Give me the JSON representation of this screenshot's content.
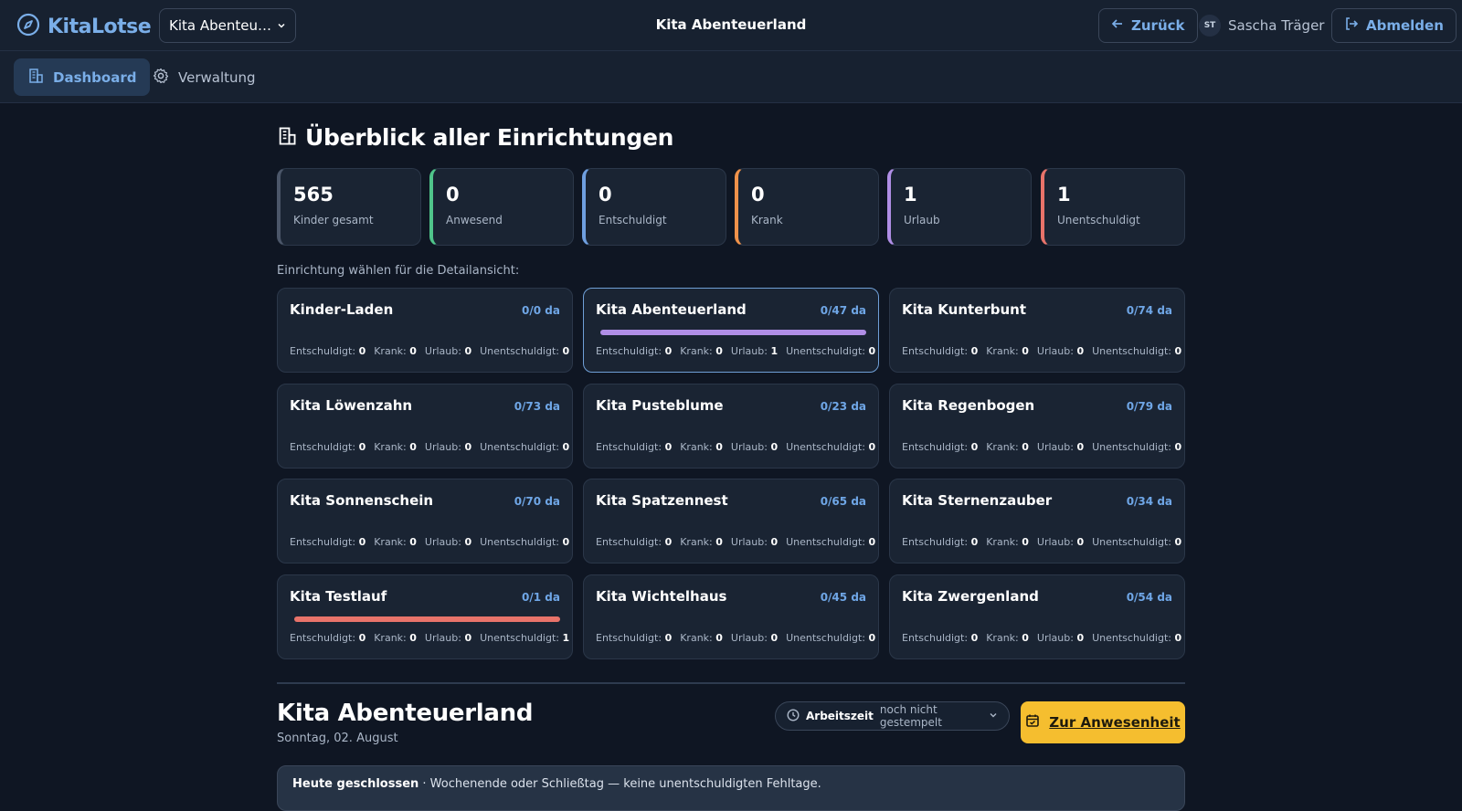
{
  "app": {
    "name": "KitaLotse"
  },
  "header": {
    "kita_selector_value": "Kita Abenteuerl...",
    "title": "Kita Abenteuerland",
    "back_label": "Zurück",
    "user_initials": "ST",
    "user_name": "Sascha Träger",
    "logout_label": "Abmelden"
  },
  "nav": [
    {
      "label": "Dashboard",
      "icon": "building-icon",
      "active": true
    },
    {
      "label": "Verwaltung",
      "icon": "gear-icon",
      "active": false
    }
  ],
  "overview": {
    "title": "Überblick aller Einrichtungen",
    "stats": [
      {
        "value": "565",
        "label": "Kinder gesamt",
        "color": "#4b5669"
      },
      {
        "value": "0",
        "label": "Anwesend",
        "color": "#4fc48a"
      },
      {
        "value": "0",
        "label": "Entschuldigt",
        "color": "#6f9fe0"
      },
      {
        "value": "0",
        "label": "Krank",
        "color": "#f0924a"
      },
      {
        "value": "1",
        "label": "Urlaub",
        "color": "#b08ee6"
      },
      {
        "value": "1",
        "label": "Unentschuldigt",
        "color": "#e8736a"
      }
    ],
    "choose_label": "Einrichtung wählen für die Detailansicht:"
  },
  "detail_labels": {
    "entschuldigt": "Entschuldigt:",
    "krank": "Krank:",
    "urlaub": "Urlaub:",
    "unentschuldigt": "Unentschuldigt:"
  },
  "facilities": [
    {
      "name": "Kinder-Laden",
      "count": "0/0 da",
      "entschuldigt": "0",
      "krank": "0",
      "urlaub": "0",
      "unentschuldigt": "0",
      "selected": false,
      "bar_color": null
    },
    {
      "name": "Kita Abenteuerland",
      "count": "0/47 da",
      "entschuldigt": "0",
      "krank": "0",
      "urlaub": "1",
      "unentschuldigt": "0",
      "selected": true,
      "bar_color": "#b08ee6"
    },
    {
      "name": "Kita Kunterbunt",
      "count": "0/74 da",
      "entschuldigt": "0",
      "krank": "0",
      "urlaub": "0",
      "unentschuldigt": "0",
      "selected": false,
      "bar_color": null
    },
    {
      "name": "Kita Löwenzahn",
      "count": "0/73 da",
      "entschuldigt": "0",
      "krank": "0",
      "urlaub": "0",
      "unentschuldigt": "0",
      "selected": false,
      "bar_color": null
    },
    {
      "name": "Kita Pusteblume",
      "count": "0/23 da",
      "entschuldigt": "0",
      "krank": "0",
      "urlaub": "0",
      "unentschuldigt": "0",
      "selected": false,
      "bar_color": null
    },
    {
      "name": "Kita Regenbogen",
      "count": "0/79 da",
      "entschuldigt": "0",
      "krank": "0",
      "urlaub": "0",
      "unentschuldigt": "0",
      "selected": false,
      "bar_color": null
    },
    {
      "name": "Kita Sonnenschein",
      "count": "0/70 da",
      "entschuldigt": "0",
      "krank": "0",
      "urlaub": "0",
      "unentschuldigt": "0",
      "selected": false,
      "bar_color": null
    },
    {
      "name": "Kita Spatzennest",
      "count": "0/65 da",
      "entschuldigt": "0",
      "krank": "0",
      "urlaub": "0",
      "unentschuldigt": "0",
      "selected": false,
      "bar_color": null
    },
    {
      "name": "Kita Sternenzauber",
      "count": "0/34 da",
      "entschuldigt": "0",
      "krank": "0",
      "urlaub": "0",
      "unentschuldigt": "0",
      "selected": false,
      "bar_color": null
    },
    {
      "name": "Kita Testlauf",
      "count": "0/1 da",
      "entschuldigt": "0",
      "krank": "0",
      "urlaub": "0",
      "unentschuldigt": "1",
      "selected": false,
      "bar_color": "#e8736a"
    },
    {
      "name": "Kita Wichtelhaus",
      "count": "0/45 da",
      "entschuldigt": "0",
      "krank": "0",
      "urlaub": "0",
      "unentschuldigt": "0",
      "selected": false,
      "bar_color": null
    },
    {
      "name": "Kita Zwergenland",
      "count": "0/54 da",
      "entschuldigt": "0",
      "krank": "0",
      "urlaub": "0",
      "unentschuldigt": "0",
      "selected": false,
      "bar_color": null
    }
  ],
  "detail": {
    "title": "Kita Abenteuerland",
    "date": "Sonntag, 02. August",
    "worktime_label": "Arbeitszeit",
    "worktime_value": "noch nicht gestempelt",
    "attendance_button": "Zur Anwesenheit",
    "notice_bold": "Heute geschlossen",
    "notice_text": " · Wochenende oder Schließtag — keine unentschuldigten Fehltage."
  },
  "colors": {
    "accent": "#7aaee8",
    "primary_button": "#f5be2f"
  }
}
